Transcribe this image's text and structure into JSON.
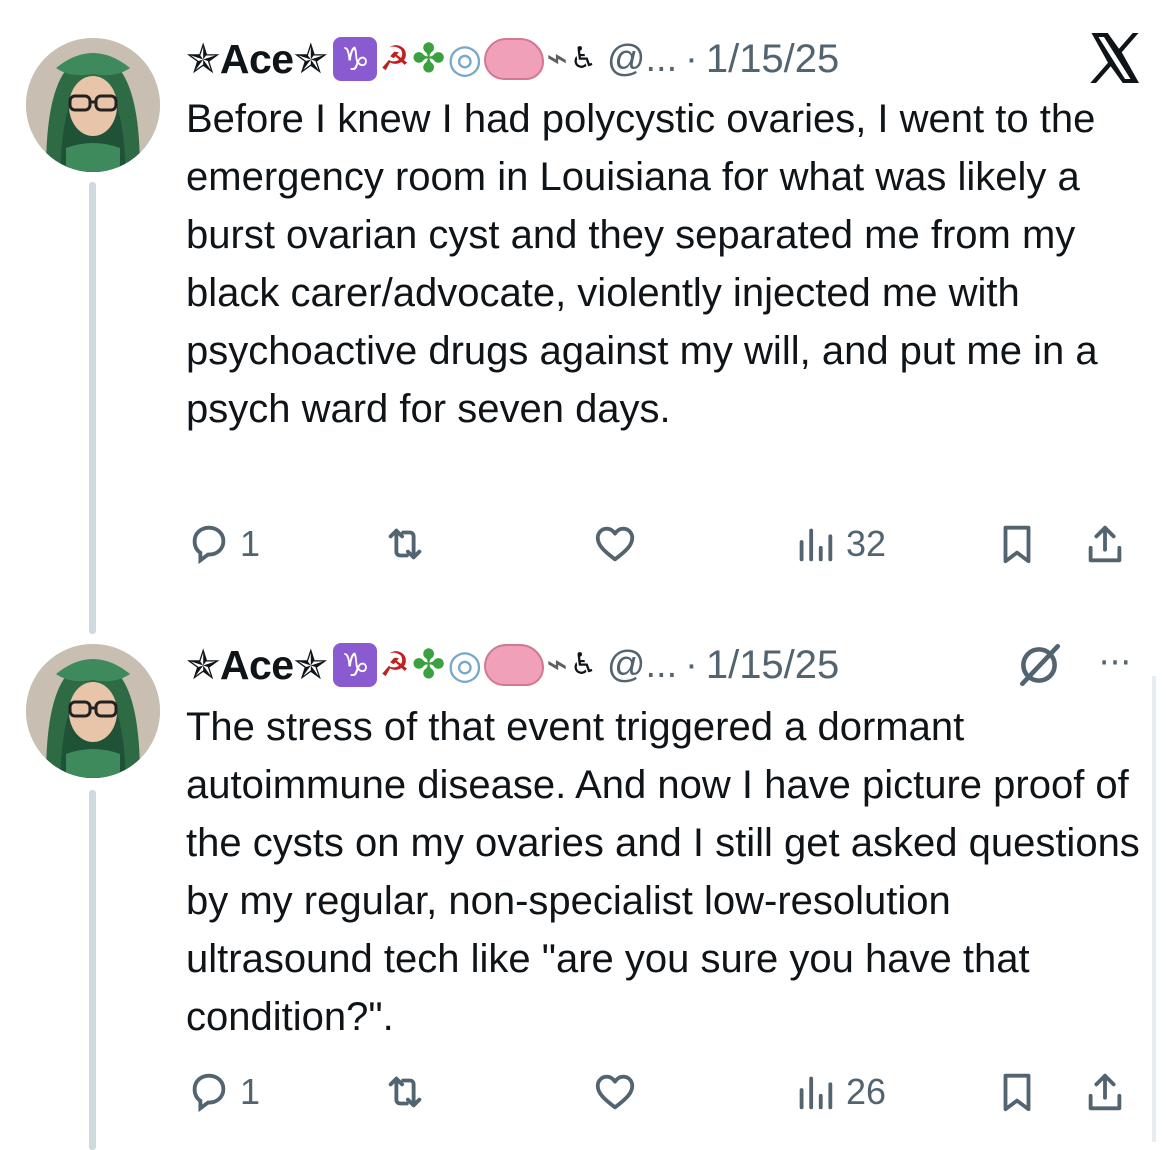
{
  "tweets": [
    {
      "author": {
        "display_name": "✯Ace✯",
        "handle": "@...",
        "emoji_sequence": [
          "capricorn-emoji",
          "hammer-and-sickle-emoji",
          "four-leaf-clover-emoji",
          "ring-emoji",
          "brain-emoji",
          "bird-emoji",
          "wheelchair-symbol-emoji"
        ]
      },
      "separator": "·",
      "date": "1/15/25",
      "body": "Before I knew I had polycystic ovaries, I went to the emergency room in Louisiana for what was likely a burst ovarian cyst and they separated me from my black carer/advocate, violently injected me with psychoactive drugs against my will, and put me in a psych ward for seven days.",
      "header_icon": "x-logo-icon",
      "actions": {
        "replies": "1",
        "reposts": "",
        "likes": "",
        "views": "32"
      }
    },
    {
      "author": {
        "display_name": "✯Ace✯",
        "handle": "@...",
        "emoji_sequence": [
          "capricorn-emoji",
          "hammer-and-sickle-emoji",
          "four-leaf-clover-emoji",
          "ring-emoji",
          "brain-emoji",
          "bird-emoji",
          "wheelchair-symbol-emoji"
        ]
      },
      "separator": "·",
      "date": "1/15/25",
      "body": "The stress of that event triggered a dormant autoimmune disease. And now I have picture proof of the cysts on my ovaries and I still get asked questions by my regular, non-specialist low-resolution ultrasound tech like \"are you sure you have that condition?\".",
      "header_icon": "grok-icon",
      "more_icon": "···",
      "actions": {
        "replies": "1",
        "reposts": "",
        "likes": "",
        "views": "26"
      }
    }
  ],
  "colors": {
    "text_primary": "#0f1419",
    "text_secondary": "#536471",
    "thread_line": "#cfd9de",
    "avatar_scarf": "#2e6b45"
  }
}
